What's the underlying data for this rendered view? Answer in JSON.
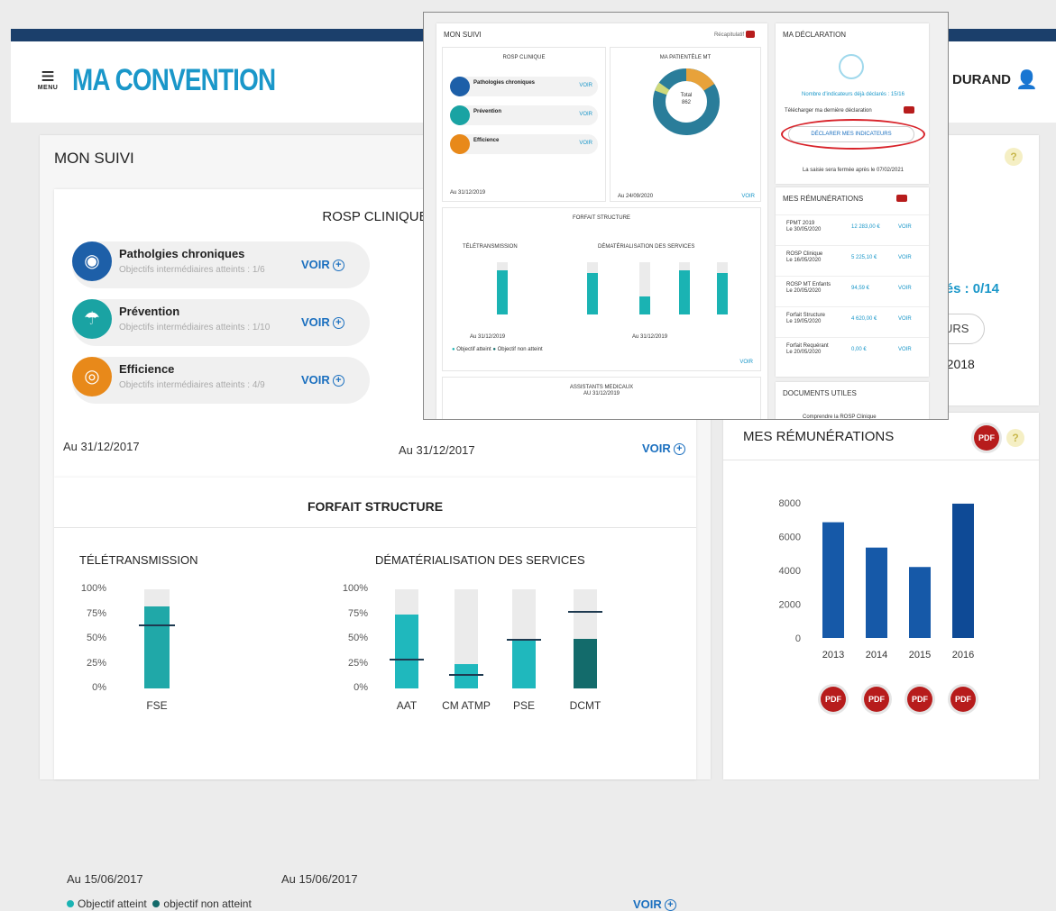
{
  "header": {
    "menu_label": "MENU",
    "brand": "MA CONVENTION",
    "user": "ie DURAND"
  },
  "main": {
    "title": "MON SUIVI",
    "rosp": {
      "title": "ROSP CLINIQUE",
      "items": [
        {
          "label": "Patholgies chroniques",
          "sub": "Objectifs intermédiaires atteints : 1/6",
          "voir": "VOIR",
          "color": "#1d5fa8"
        },
        {
          "label": "Prévention",
          "sub": "Objectifs intermédiaires atteints : 1/10",
          "voir": "VOIR",
          "color": "#1aa3a3"
        },
        {
          "label": "Efficience",
          "sub": "Objectifs intermédiaires atteints : 4/9",
          "voir": "VOIR",
          "color": "#e8891a"
        }
      ],
      "date_left": "Au 31/12/2017",
      "date_right": "Au 31/12/2017",
      "voir": "VOIR"
    },
    "forfait": {
      "title": "FORFAIT STRUCTURE",
      "teletrans": {
        "title": "TÉLÉTRANSMISSION",
        "date": "Au 15/06/2017"
      },
      "demat": {
        "title": "DÉMATÉRIALISATION DES SERVICES",
        "date": "Au 15/06/2017"
      },
      "axis": [
        "100%",
        "75%",
        "50%",
        "25%",
        "0%"
      ],
      "legend_reached": "Objectif atteint",
      "legend_not": "objectif non atteint",
      "voir": "VOIR"
    }
  },
  "chart_data": [
    {
      "type": "bar",
      "title": "TÉLÉTRANSMISSION",
      "categories": [
        "FSE"
      ],
      "values": [
        83
      ],
      "targets": [
        65
      ],
      "ylim": [
        0,
        100
      ]
    },
    {
      "type": "bar",
      "title": "DÉMATÉRIALISATION DES SERVICES",
      "categories": [
        "AAT",
        "CM ATMP",
        "PSE",
        "DCMT"
      ],
      "values": [
        75,
        25,
        50,
        50
      ],
      "targets": [
        30,
        15,
        50,
        78
      ],
      "ylim": [
        0,
        100
      ]
    },
    {
      "type": "bar",
      "title": "MES RÉMUNÉRATIONS",
      "categories": [
        "2013",
        "2014",
        "2015",
        "2016"
      ],
      "values": [
        6850,
        5350,
        4200,
        7950
      ],
      "ylim": [
        0,
        8000
      ],
      "yticks": [
        "8000",
        "6000",
        "4000",
        "2000",
        "0"
      ]
    }
  ],
  "side": {
    "partial1": "rés : 0/14",
    "partial2": "URS",
    "partial3": "2/2018",
    "help": "?"
  },
  "remunerations": {
    "title": "MES RÉMUNÉRATIONS",
    "pdf": "PDF",
    "help": "?"
  },
  "overlay": {
    "mon_suivi": "MON SUIVI",
    "recap": "Récapitulatif",
    "rosp_title": "ROSP CLINIQUE",
    "patientele": "MA PATIENTÈLE MT",
    "items": [
      "Pathologies chroniques",
      "Prévention",
      "Efficience"
    ],
    "total": "Total",
    "total_val": "862",
    "date1": "Au 31/12/2019",
    "date2": "Au 24/09/2020",
    "forfait": "FORFAIT STRUCTURE",
    "tele": "TÉLÉTRANSMISSION",
    "demat": "DÉMATÉRIALISATION DES SERVICES",
    "fd1": "Au 31/12/2019",
    "fd2": "Au 31/12/2019",
    "leg1": "Objectif atteint",
    "leg2": "Objectif non atteint",
    "assist": "ASSISTANTS MEDICAUX",
    "assist_date": "AU 31/12/2019",
    "declar": "MA DÉCLARATION",
    "nb": "Nombre d'indicateurs déjà déclarés : 15/16",
    "telech": "Télécharger ma dernière déclaration",
    "btn": "DÉCLARER MES INDICATEURS",
    "saisie": "La saisie sera fermée après le 07/02/2021",
    "remun": "MES RÉMUNÉRATIONS",
    "rows": [
      {
        "l1": "FPMT 2019",
        "l2": "Le 30/05/2020",
        "amt": "12 283,00 €"
      },
      {
        "l1": "ROSP Clinique",
        "l2": "Le 16/05/2020",
        "amt": "5 225,10 €"
      },
      {
        "l1": "ROSP MT Enfants",
        "l2": "Le 20/05/2020",
        "amt": "94,59 €"
      },
      {
        "l1": "Forfait Structure",
        "l2": "Le 19/05/2020",
        "amt": "4 620,00 €"
      },
      {
        "l1": "Forfait Requérant",
        "l2": "Le 20/05/2020",
        "amt": "0,00 €"
      }
    ],
    "voir": "VOIR",
    "docs": "DOCUMENTS UTILES",
    "doc1": "Comprendre la ROSP Clinique"
  }
}
